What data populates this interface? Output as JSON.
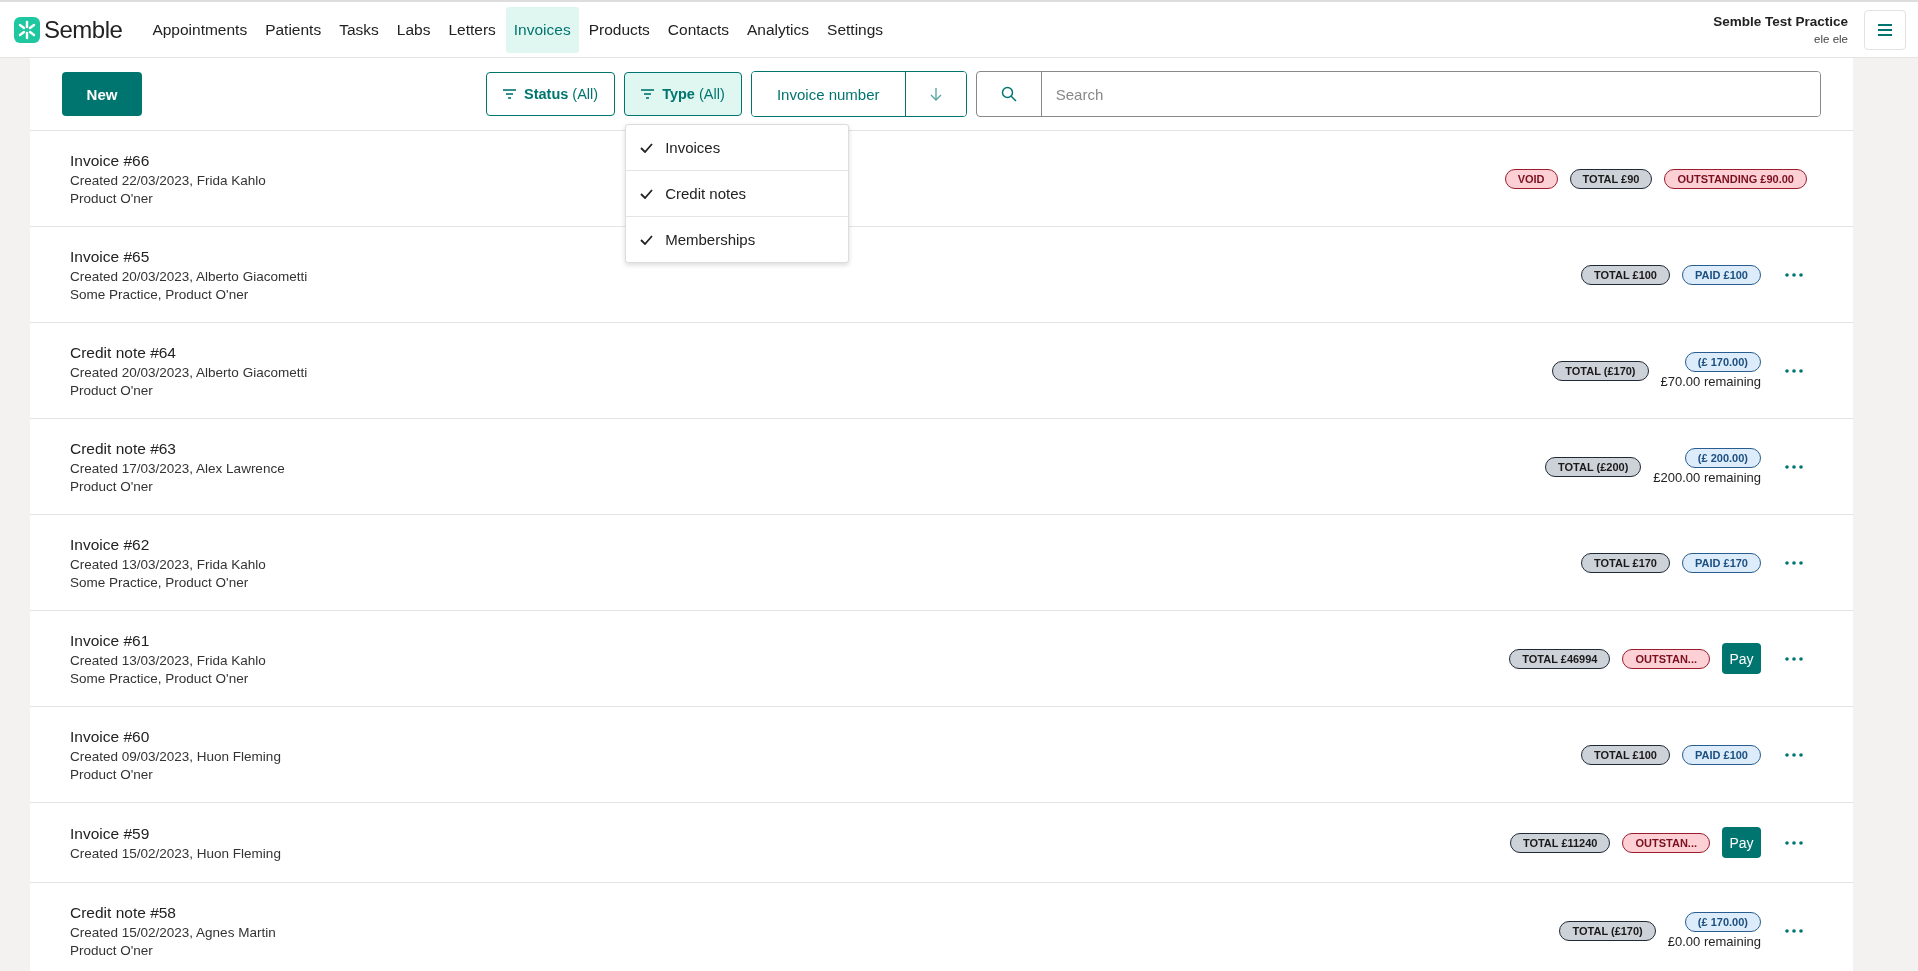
{
  "brand": {
    "name": "Semble"
  },
  "nav": [
    {
      "label": "Appointments",
      "selected": false
    },
    {
      "label": "Patients",
      "selected": false
    },
    {
      "label": "Tasks",
      "selected": false
    },
    {
      "label": "Labs",
      "selected": false
    },
    {
      "label": "Letters",
      "selected": false
    },
    {
      "label": "Invoices",
      "selected": true
    },
    {
      "label": "Products",
      "selected": false
    },
    {
      "label": "Contacts",
      "selected": false
    },
    {
      "label": "Analytics",
      "selected": false
    },
    {
      "label": "Settings",
      "selected": false
    }
  ],
  "account": {
    "practice": "Semble Test Practice",
    "user": "ele ele"
  },
  "toolbar": {
    "new_button": "New",
    "filters": [
      {
        "label": "Status",
        "value": "(All)",
        "selected": false
      },
      {
        "label": "Type",
        "value": "(All)",
        "selected": true
      }
    ],
    "sort": {
      "label": "Invoice number"
    },
    "search": {
      "placeholder": "Search"
    }
  },
  "type_menu": [
    {
      "label": "Invoices",
      "checked": true
    },
    {
      "label": "Credit notes",
      "checked": true
    },
    {
      "label": "Memberships",
      "checked": true
    }
  ],
  "invoices": [
    {
      "title": "Invoice #66",
      "lines": [
        "Created 22/03/2023, Frida Kahlo",
        "Product O'ner"
      ],
      "badges": [
        {
          "kind": "void",
          "text": "VOID"
        },
        {
          "kind": "total",
          "text": "TOTAL £90"
        },
        {
          "kind": "outstanding",
          "text": "OUTSTANDING £90.00"
        }
      ],
      "menu": false
    },
    {
      "title": "Invoice #65",
      "lines": [
        "Created 20/03/2023, Alberto Giacometti",
        "Some Practice, Product O'ner"
      ],
      "badges": [
        {
          "kind": "total",
          "text": "TOTAL £100"
        },
        {
          "kind": "paid",
          "text": "PAID £100"
        }
      ],
      "menu": true
    },
    {
      "title": "Credit note #64",
      "lines": [
        "Created 20/03/2023, Alberto Giacometti",
        "Product O'ner"
      ],
      "badges": [
        {
          "kind": "total",
          "text": "TOTAL (£170)"
        },
        {
          "kind": "credit",
          "text": "(£ 170.00)",
          "remaining": "£70.00 remaining"
        }
      ],
      "menu": true
    },
    {
      "title": "Credit note #63",
      "lines": [
        "Created 17/03/2023, Alex Lawrence",
        "Product O'ner"
      ],
      "badges": [
        {
          "kind": "total",
          "text": "TOTAL (£200)"
        },
        {
          "kind": "credit",
          "text": "(£ 200.00)",
          "remaining": "£200.00 remaining"
        }
      ],
      "menu": true
    },
    {
      "title": "Invoice #62",
      "lines": [
        "Created 13/03/2023, Frida Kahlo",
        "Some Practice, Product O'ner"
      ],
      "badges": [
        {
          "kind": "total",
          "text": "TOTAL £170"
        },
        {
          "kind": "paid",
          "text": "PAID £170"
        }
      ],
      "menu": true
    },
    {
      "title": "Invoice #61",
      "lines": [
        "Created 13/03/2023, Frida Kahlo",
        "Some Practice, Product O'ner"
      ],
      "badges": [
        {
          "kind": "total",
          "text": "TOTAL £46994"
        },
        {
          "kind": "outstanding",
          "text": "OUTSTAN..."
        }
      ],
      "pay": "Pay",
      "menu": true
    },
    {
      "title": "Invoice #60",
      "lines": [
        "Created 09/03/2023, Huon Fleming",
        "Product O'ner"
      ],
      "badges": [
        {
          "kind": "total",
          "text": "TOTAL £100"
        },
        {
          "kind": "paid",
          "text": "PAID £100"
        }
      ],
      "menu": true
    },
    {
      "title": "Invoice #59",
      "lines": [
        "Created 15/02/2023, Huon Fleming"
      ],
      "badges": [
        {
          "kind": "total",
          "text": "TOTAL £11240"
        },
        {
          "kind": "outstanding",
          "text": "OUTSTAN..."
        }
      ],
      "pay": "Pay",
      "menu": true
    },
    {
      "title": "Credit note #58",
      "lines": [
        "Created 15/02/2023, Agnes Martin",
        "Product O'ner"
      ],
      "badges": [
        {
          "kind": "total",
          "text": "TOTAL (£170)"
        },
        {
          "kind": "credit",
          "text": "(£ 170.00)",
          "remaining": "£0.00 remaining"
        }
      ],
      "menu": true
    }
  ]
}
